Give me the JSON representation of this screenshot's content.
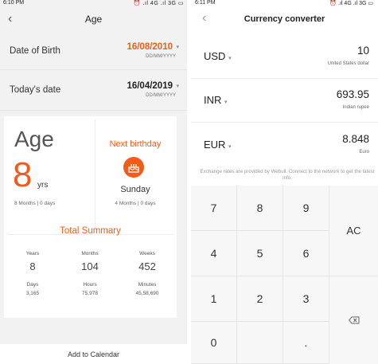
{
  "left": {
    "status_time": "6:10 PM",
    "status_icons": "⏰ .ıl 4G .ıl 3G ▭",
    "title": "Age",
    "dob": {
      "label": "Date of Birth",
      "value": "16/08/2010",
      "format": "DD/MM/YYYY"
    },
    "today": {
      "label": "Today's date",
      "value": "16/04/2019",
      "format": "DD/MM/YYYY"
    },
    "age": {
      "title": "Age",
      "years": "8",
      "unit": "yrs",
      "detail": "8 Months | 0 days"
    },
    "next_birthday": {
      "title": "Next birthday",
      "day": "Sunday",
      "detail": "4 Months | 0 days"
    },
    "summary": {
      "title": "Total Summary",
      "items": [
        {
          "label": "Years",
          "value": "8"
        },
        {
          "label": "Months",
          "value": "104"
        },
        {
          "label": "Weeks",
          "value": "452"
        },
        {
          "label": "Days",
          "value": "3,165"
        },
        {
          "label": "Hours",
          "value": "75,978"
        },
        {
          "label": "Minutes",
          "value": "45,58,690"
        }
      ]
    },
    "add_calendar": "Add to Calendar"
  },
  "right": {
    "status_time": "6:11 PM",
    "status_icons": "⏰ .ıl 4G .ıl 3G ▭",
    "title": "Currency converter",
    "currencies": [
      {
        "code": "USD",
        "amount": "10",
        "name": "United States dollar",
        "color": "#f25c19"
      },
      {
        "code": "INR",
        "amount": "693.95",
        "name": "Indian rupee",
        "color": "#222222"
      },
      {
        "code": "EUR",
        "amount": "8.848",
        "name": "Euro",
        "color": "#222222"
      }
    ],
    "note": "Exchange rates are provided by Webull. Connect to the network to get the latest info.",
    "keys": [
      "7",
      "8",
      "9",
      "4",
      "5",
      "6",
      "1",
      "2",
      "3",
      "0",
      "."
    ],
    "clear_label": "AC"
  },
  "colors": {
    "accent": "#f25c19"
  }
}
